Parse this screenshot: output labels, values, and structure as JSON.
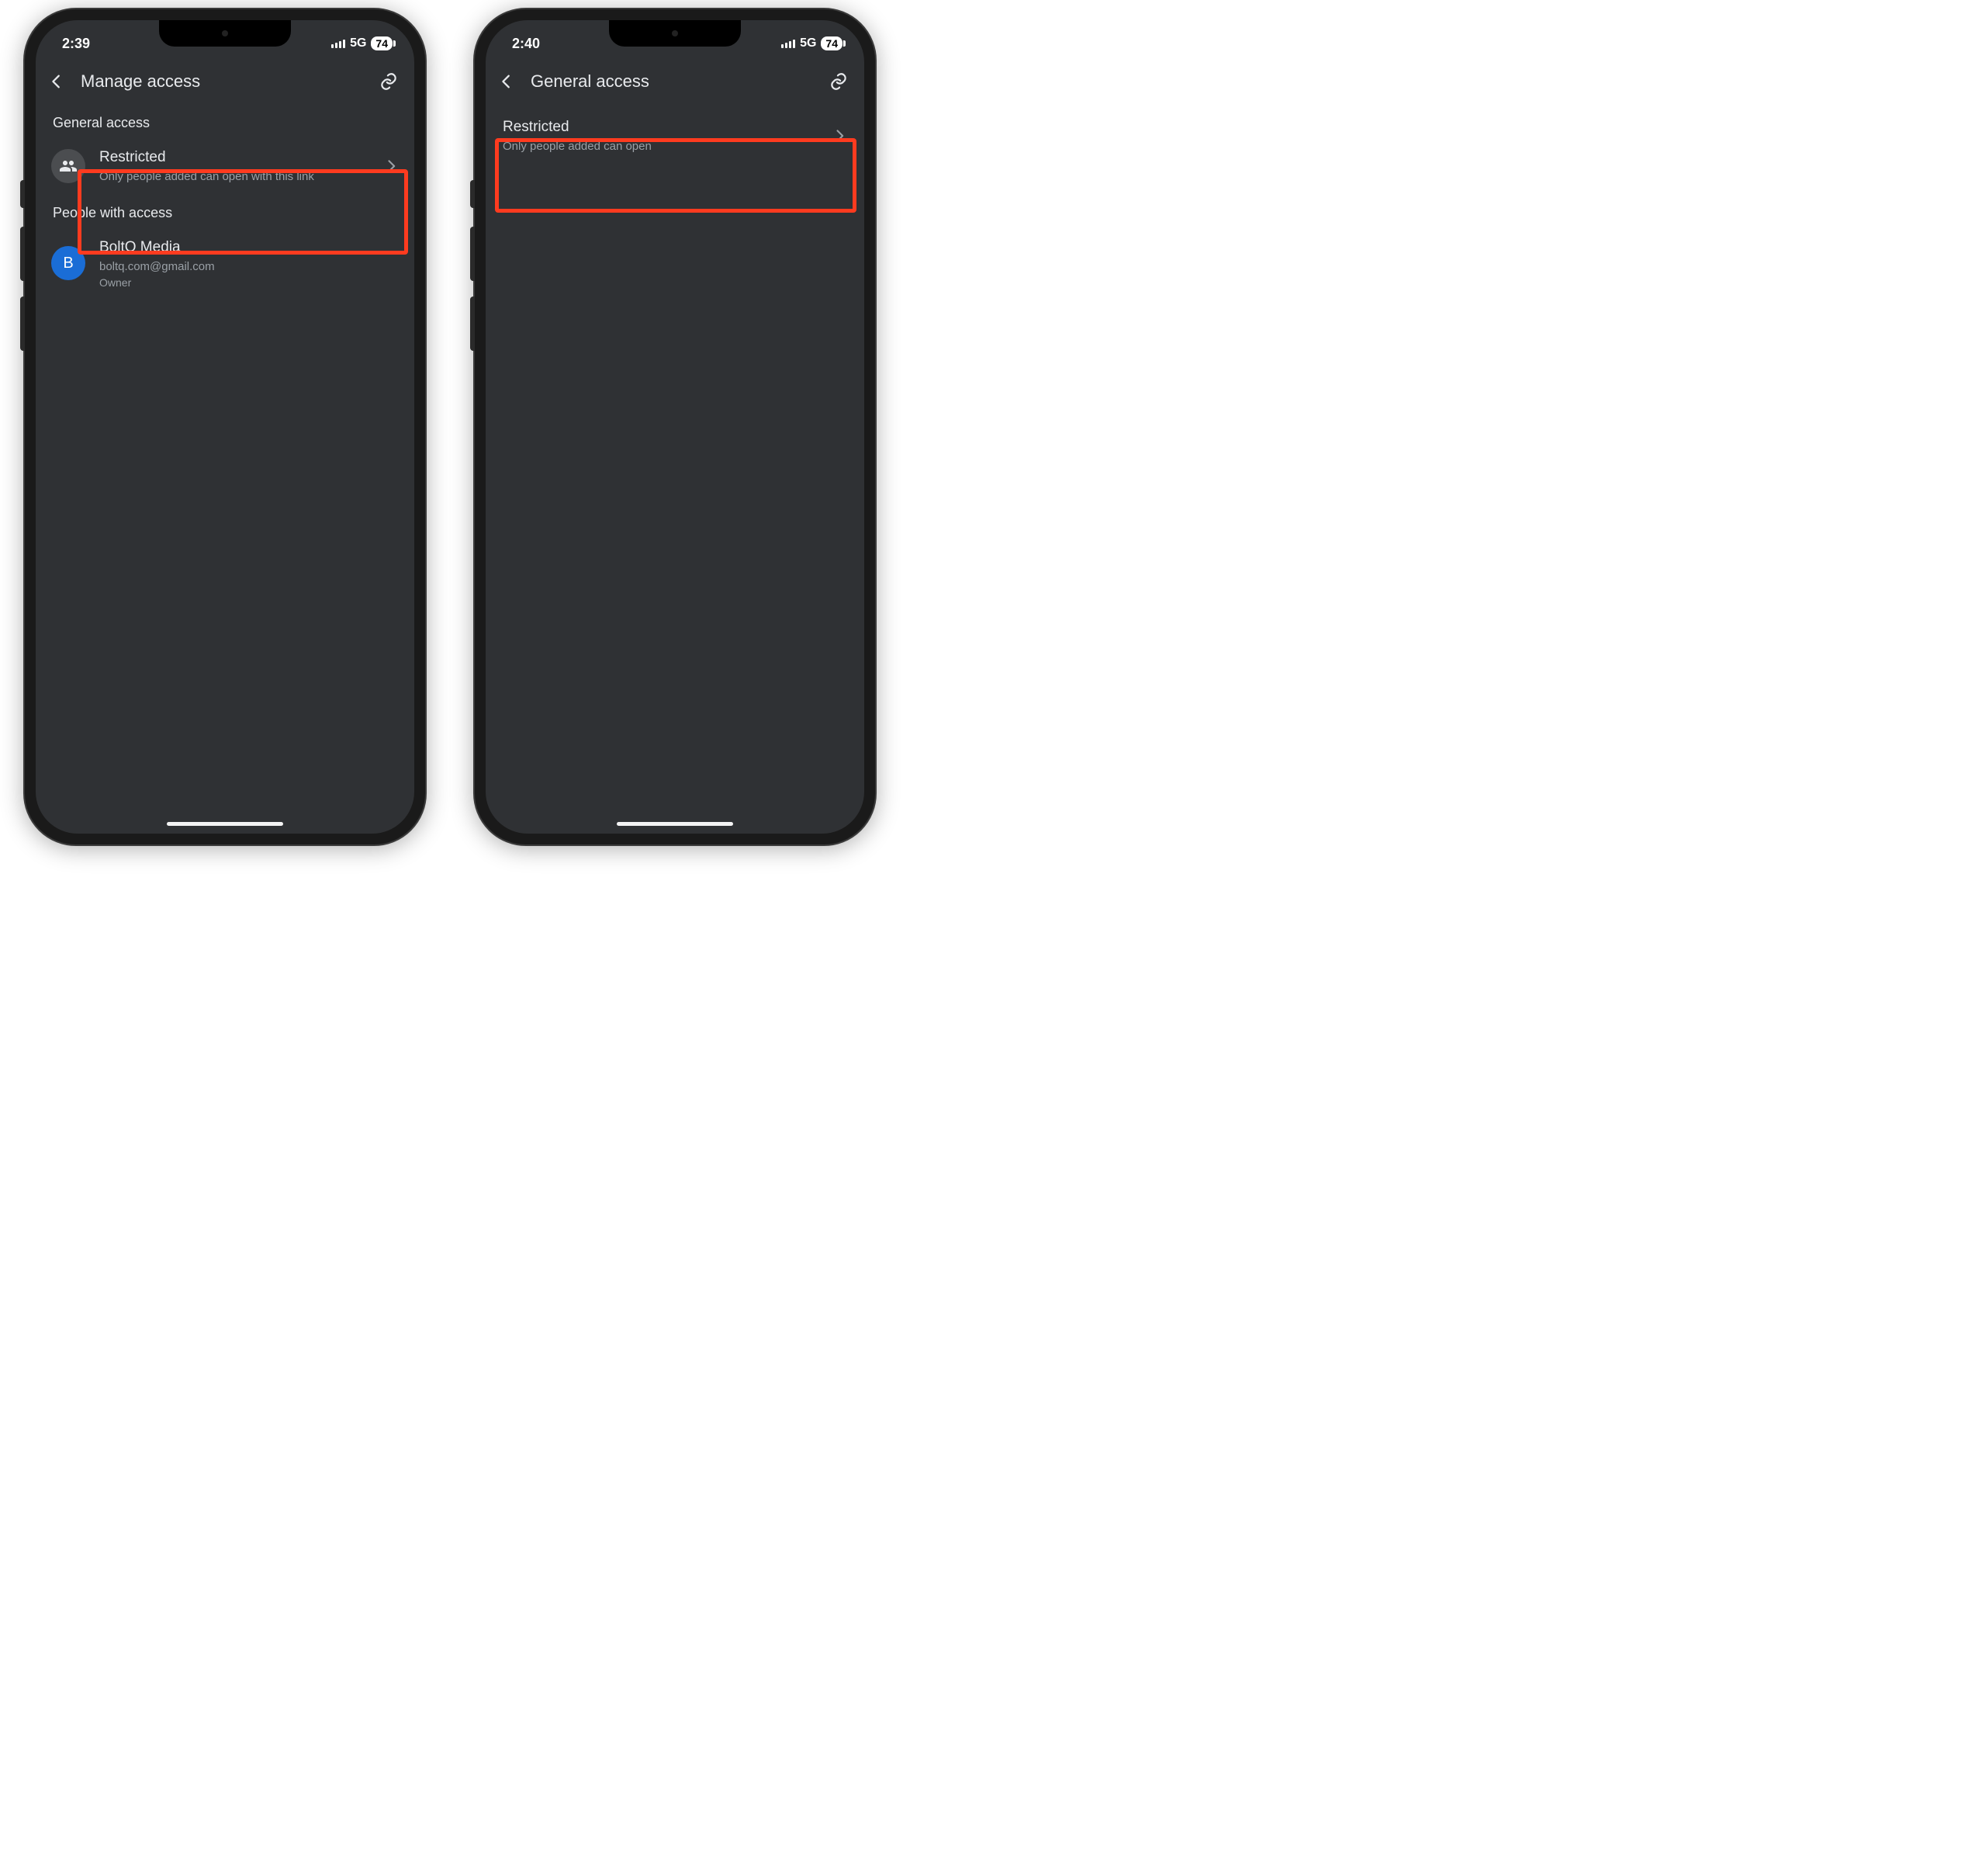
{
  "left": {
    "status": {
      "time": "2:39",
      "network": "5G",
      "battery": "74"
    },
    "title": "Manage access",
    "general_label": "General access",
    "restricted": {
      "title": "Restricted",
      "subtitle": "Only people added can open with this link"
    },
    "people_label": "People with access",
    "person": {
      "initial": "B",
      "name": "BoltQ Media",
      "email": "boltq.com@gmail.com",
      "role": "Owner"
    }
  },
  "right": {
    "status": {
      "time": "2:40",
      "network": "5G",
      "battery": "74"
    },
    "title": "General access",
    "restricted": {
      "title": "Restricted",
      "subtitle": "Only people added can open"
    }
  }
}
